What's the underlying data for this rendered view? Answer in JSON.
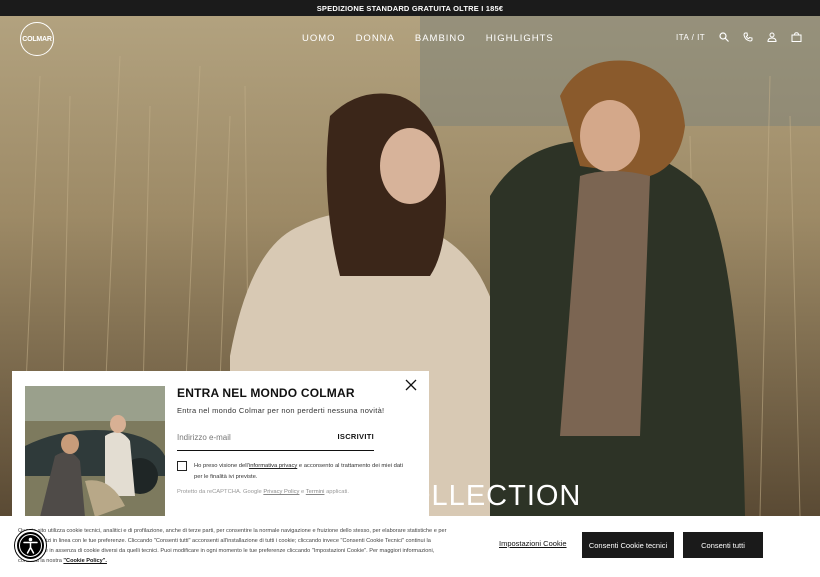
{
  "topbar": {
    "text": "SPEDIZIONE STANDARD GRATUITA OLTRE I 185€"
  },
  "header": {
    "logo_text": "COLMAR",
    "nav": [
      "UOMO",
      "DONNA",
      "BAMBINO",
      "HIGHLIGHTS"
    ],
    "language": "ITA / IT"
  },
  "hero": {
    "title_partial": "OLLECTION"
  },
  "newsletter": {
    "title": "ENTRA NEL MONDO COLMAR",
    "subtitle": "Entra nel mondo Colmar per non perderti nessuna novità!",
    "email_placeholder": "Indirizzo e-mail",
    "subscribe_label": "ISCRIVITI",
    "consent_before": "Ho preso visione dell'",
    "consent_link": "informativa privacy",
    "consent_after": " e acconsento al trattamento dei miei dati per le finalità ivi previste.",
    "recaptcha_before": "Protetto da reCAPTCHA. Google ",
    "privacy_link": "Privacy Policy",
    "recaptcha_mid": " e ",
    "terms_link": "Termini",
    "recaptcha_after": " applicati."
  },
  "cookies": {
    "text": "Questo sito utilizza cookie tecnici, analitici e di profilazione, anche di terze parti, per consentire la normale navigazione e fruizione dello stesso, per elaborare statistiche e per fornire servizi in linea con le tue preferenze. Cliccando \"Consenti tutti\" acconsenti all'installazione di tutti i cookie; cliccando invece \"Consenti Cookie Tecnici\" continui la navigazione in assenza di cookie diversi da quelli tecnici. Puoi modificare in ogni momento le tue preferenze cliccando \"Impostazioni Cookie\". Per maggiori informazioni, consulta la nostra ",
    "policy_link": "\"Cookie Policy\".",
    "settings_label": "Impostazioni Cookie",
    "technical_label": "Consenti Cookie tecnici",
    "all_label": "Consenti tutti"
  },
  "colors": {
    "dark": "#1a1a1a",
    "white": "#ffffff"
  }
}
